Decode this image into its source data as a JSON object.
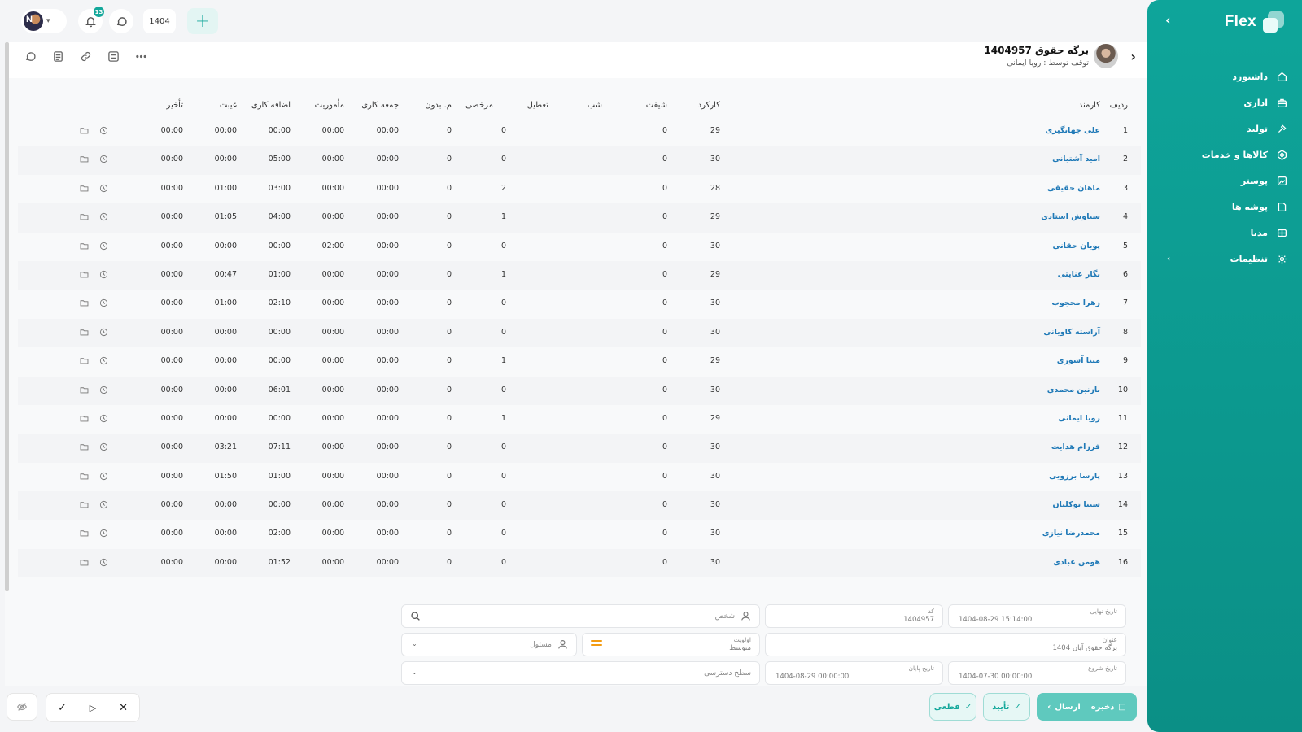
{
  "app": {
    "name": "Flex"
  },
  "topbar": {
    "notifications_count": "13",
    "year": "1404",
    "add_symbol": "+"
  },
  "sidebar": {
    "items": [
      {
        "label": "داشبورد",
        "icon": "home-icon"
      },
      {
        "label": "اداری",
        "icon": "briefcase-icon"
      },
      {
        "label": "تولید",
        "icon": "tools-icon"
      },
      {
        "label": "کالاها و خدمات",
        "icon": "box-icon"
      },
      {
        "label": "پوستر",
        "icon": "image-icon"
      },
      {
        "label": "پوشه ها",
        "icon": "folder-icon"
      },
      {
        "label": "مدیا",
        "icon": "media-icon"
      },
      {
        "label": "تنظیمات",
        "icon": "gear-icon"
      }
    ]
  },
  "document": {
    "title": "برگه حقوق 1404957",
    "subtitle": "توقف توسط : رویا ایمانی"
  },
  "table": {
    "headers": {
      "row": "ردیف",
      "employee": "کارمند",
      "workdays": "کارکرد",
      "shift": "شیفت",
      "night": "شب",
      "holiday": "تعطیل",
      "leave": "مرخصی",
      "unpaid": "م. بدون",
      "friday": "جمعه کاری",
      "mission": "مأموریت",
      "overtime": "اضافه کاری",
      "absence": "غیبت",
      "delay": "تأخیر"
    },
    "rows": [
      {
        "n": "1",
        "name": "علی جهانگیری",
        "work": "29",
        "shift": "0",
        "leave": "0",
        "unpaid": "0",
        "friday": "00:00",
        "mission": "00:00",
        "overtime": "00:00",
        "absence": "00:00",
        "delay": "00:00"
      },
      {
        "n": "2",
        "name": "امید آشتیانی",
        "work": "30",
        "shift": "0",
        "leave": "0",
        "unpaid": "0",
        "friday": "00:00",
        "mission": "00:00",
        "overtime": "05:00",
        "absence": "00:00",
        "delay": "00:00"
      },
      {
        "n": "3",
        "name": "ماهان حقیقی",
        "work": "28",
        "shift": "0",
        "leave": "2",
        "unpaid": "0",
        "friday": "00:00",
        "mission": "00:00",
        "overtime": "03:00",
        "absence": "01:00",
        "delay": "00:00"
      },
      {
        "n": "4",
        "name": "سیاوش استادی",
        "work": "29",
        "shift": "0",
        "leave": "1",
        "unpaid": "0",
        "friday": "00:00",
        "mission": "00:00",
        "overtime": "04:00",
        "absence": "01:05",
        "delay": "00:00"
      },
      {
        "n": "5",
        "name": "پویان حقانی",
        "work": "30",
        "shift": "0",
        "leave": "0",
        "unpaid": "0",
        "friday": "00:00",
        "mission": "02:00",
        "overtime": "00:00",
        "absence": "00:00",
        "delay": "00:00"
      },
      {
        "n": "6",
        "name": "نگار عنایتی",
        "work": "29",
        "shift": "0",
        "leave": "1",
        "unpaid": "0",
        "friday": "00:00",
        "mission": "00:00",
        "overtime": "01:00",
        "absence": "00:47",
        "delay": "00:00"
      },
      {
        "n": "7",
        "name": "زهرا محجوب",
        "work": "30",
        "shift": "0",
        "leave": "0",
        "unpaid": "0",
        "friday": "00:00",
        "mission": "00:00",
        "overtime": "02:10",
        "absence": "01:00",
        "delay": "00:00"
      },
      {
        "n": "8",
        "name": "آراسته کاویانی",
        "work": "30",
        "shift": "0",
        "leave": "0",
        "unpaid": "0",
        "friday": "00:00",
        "mission": "00:00",
        "overtime": "00:00",
        "absence": "00:00",
        "delay": "00:00"
      },
      {
        "n": "9",
        "name": "مینا آشوری",
        "work": "29",
        "shift": "0",
        "leave": "1",
        "unpaid": "0",
        "friday": "00:00",
        "mission": "00:00",
        "overtime": "00:00",
        "absence": "00:00",
        "delay": "00:00"
      },
      {
        "n": "10",
        "name": "نازنین محمدی",
        "work": "30",
        "shift": "0",
        "leave": "0",
        "unpaid": "0",
        "friday": "00:00",
        "mission": "00:00",
        "overtime": "06:01",
        "absence": "00:00",
        "delay": "00:00"
      },
      {
        "n": "11",
        "name": "رویا ایمانی",
        "work": "29",
        "shift": "0",
        "leave": "1",
        "unpaid": "0",
        "friday": "00:00",
        "mission": "00:00",
        "overtime": "00:00",
        "absence": "00:00",
        "delay": "00:00"
      },
      {
        "n": "12",
        "name": "فرزام هدایت",
        "work": "30",
        "shift": "0",
        "leave": "0",
        "unpaid": "0",
        "friday": "00:00",
        "mission": "00:00",
        "overtime": "07:11",
        "absence": "03:21",
        "delay": "00:00"
      },
      {
        "n": "13",
        "name": "پارسا برزویی",
        "work": "30",
        "shift": "0",
        "leave": "0",
        "unpaid": "0",
        "friday": "00:00",
        "mission": "00:00",
        "overtime": "01:00",
        "absence": "01:50",
        "delay": "00:00"
      },
      {
        "n": "14",
        "name": "سینا توکلیان",
        "work": "30",
        "shift": "0",
        "leave": "0",
        "unpaid": "0",
        "friday": "00:00",
        "mission": "00:00",
        "overtime": "00:00",
        "absence": "00:00",
        "delay": "00:00"
      },
      {
        "n": "15",
        "name": "محمدرضا نیازی",
        "work": "30",
        "shift": "0",
        "leave": "0",
        "unpaid": "0",
        "friday": "00:00",
        "mission": "00:00",
        "overtime": "02:00",
        "absence": "00:00",
        "delay": "00:00"
      },
      {
        "n": "16",
        "name": "هومن عبادی",
        "work": "30",
        "shift": "0",
        "leave": "0",
        "unpaid": "0",
        "friday": "00:00",
        "mission": "00:00",
        "overtime": "01:52",
        "absence": "00:00",
        "delay": "00:00"
      }
    ]
  },
  "form": {
    "due_date": {
      "label": "تاریخ نهایی",
      "value": "1404-08-29 15:14:00"
    },
    "code": {
      "label": "کد",
      "value": "1404957"
    },
    "person": {
      "placeholder": "شخص"
    },
    "title": {
      "label": "عنوان",
      "value": "برگه حقوق آبان 1404"
    },
    "priority": {
      "label": "اولویت",
      "value": "متوسط"
    },
    "responsible": {
      "placeholder": "مسئول"
    },
    "start_date": {
      "label": "تاریخ شروع",
      "value": "1404-07-30 00:00:00"
    },
    "end_date": {
      "label": "تاریخ پایان",
      "value": "1404-08-29 00:00:00"
    },
    "access_level": {
      "placeholder": "سطح دسترسی"
    }
  },
  "footer": {
    "save_label": "ذخیره",
    "send_label": "ارسال",
    "confirm_label": "تأیید",
    "final_label": "قطعی",
    "accent_color": "#14a89b"
  }
}
